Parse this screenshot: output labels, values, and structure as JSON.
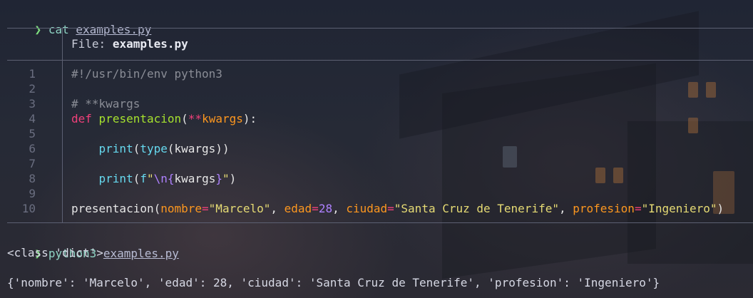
{
  "prompt": {
    "arrow": "❯"
  },
  "command1": {
    "cmd": "cat",
    "file": "examples.py"
  },
  "header": {
    "file_label": "File:",
    "file_name": "examples.py"
  },
  "code_lines": [
    {
      "num": "1",
      "text": "#!/usr/bin/env python3"
    },
    {
      "num": "2",
      "text": ""
    },
    {
      "num": "3",
      "text": "# **kwargs"
    },
    {
      "num": "4",
      "text": "def presentacion(**kwargs):"
    },
    {
      "num": "5",
      "text": ""
    },
    {
      "num": "6",
      "text": "    print(type(kwargs))"
    },
    {
      "num": "7",
      "text": ""
    },
    {
      "num": "8",
      "text": "    print(f\"\\n{kwargs}\")"
    },
    {
      "num": "9",
      "text": ""
    },
    {
      "num": "10",
      "text": "presentacion(nombre=\"Marcelo\", edad=28, ciudad=\"Santa Cruz de Tenerife\", profesion=\"Ingeniero\")"
    }
  ],
  "command2": {
    "cmd": "python3",
    "file": "examples.py"
  },
  "output": [
    "<class 'dict'>",
    "",
    "{'nombre': 'Marcelo', 'edad': 28, 'ciudad': 'Santa Cruz de Tenerife', 'profesion': 'Ingeniero'}"
  ]
}
